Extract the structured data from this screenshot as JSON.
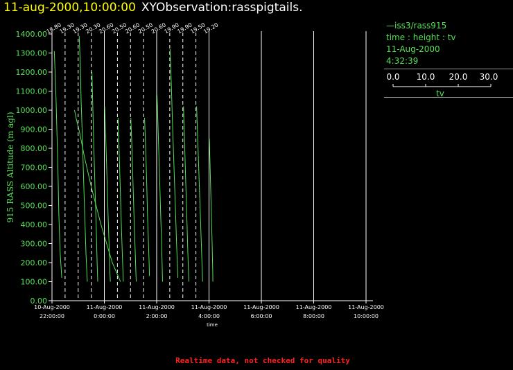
{
  "header": {
    "date": "11-aug-2000,10:00:00",
    "title": "XYObservation:rasspigtails."
  },
  "legend": {
    "source": "—iss3/rass915",
    "axes": "time : height : tv",
    "date": "11-Aug-2000",
    "time": "4:32:39",
    "scale_ticks": [
      "0.0",
      "10.0",
      "20.0",
      "30.0"
    ],
    "scale_label": "tv"
  },
  "footer": "Realtime data, not checked for quality",
  "colors": {
    "header_date": "#ffff00",
    "series": "#55e055",
    "axis": "#ffffff",
    "footer": "#ff2020"
  },
  "chart_data": {
    "type": "line",
    "ylabel": "915 RASS Altitude (m agl)",
    "xlabel": "time",
    "ylim": [
      0,
      1400
    ],
    "y_ticks": [
      "0.00",
      "100.00",
      "200.00",
      "300.00",
      "400.00",
      "500.00",
      "600.00",
      "700.00",
      "800.00",
      "900.00",
      "1000.00",
      "1100.00",
      "1200.00",
      "1300.00",
      "1400.00"
    ],
    "x_ticks": [
      {
        "date": "10-Aug-2000",
        "time": "22:00:00"
      },
      {
        "date": "11-Aug-2000",
        "time": "0:00:00"
      },
      {
        "date": "11-Aug-2000",
        "time": "2:00:00"
      },
      {
        "date": "11-Aug-2000",
        "time": "4:00:00"
      },
      {
        "date": "11-Aug-2000",
        "time": "6:00:00"
      },
      {
        "date": "11-Aug-2000",
        "time": "8:00:00"
      },
      {
        "date": "11-Aug-2000",
        "time": "10:00:00"
      }
    ],
    "profiles": [
      {
        "label": "18.80",
        "points": [
          [
            0.7,
            1310
          ],
          [
            0.95,
            1200
          ],
          [
            1.25,
            1050
          ],
          [
            1.5,
            900
          ],
          [
            1.8,
            700
          ],
          [
            2.1,
            450
          ],
          [
            2.5,
            250
          ],
          [
            3.0,
            120
          ]
        ]
      },
      {
        "label": "19.30",
        "points": [
          [
            2.9,
            1000
          ],
          [
            3.5,
            950
          ],
          [
            4.5,
            880
          ],
          [
            6.0,
            750
          ],
          [
            8.0,
            600
          ],
          [
            11.0,
            400
          ],
          [
            14.5,
            200
          ],
          [
            17.0,
            100
          ]
        ]
      },
      {
        "label": "19.30",
        "points": [
          [
            0.3,
            1390
          ],
          [
            0.65,
            1250
          ],
          [
            0.9,
            1050
          ],
          [
            1.3,
            850
          ],
          [
            1.65,
            650
          ],
          [
            2.0,
            450
          ],
          [
            2.4,
            250
          ],
          [
            2.8,
            100
          ]
        ]
      },
      {
        "label": "20.30",
        "points": [
          [
            0.2,
            1200
          ],
          [
            0.5,
            1000
          ],
          [
            0.8,
            800
          ],
          [
            1.15,
            600
          ],
          [
            1.5,
            400
          ],
          [
            1.8,
            200
          ],
          [
            2.0,
            100
          ]
        ]
      },
      {
        "label": "20.60",
        "points": [
          [
            0.1,
            1020
          ],
          [
            0.45,
            850
          ],
          [
            0.8,
            650
          ],
          [
            1.15,
            450
          ],
          [
            1.45,
            300
          ],
          [
            1.7,
            150
          ],
          [
            1.85,
            100
          ]
        ]
      },
      {
        "label": "20.50",
        "points": [
          [
            0.2,
            960
          ],
          [
            0.5,
            800
          ],
          [
            0.85,
            600
          ],
          [
            1.2,
            400
          ],
          [
            1.5,
            250
          ],
          [
            1.7,
            150
          ],
          [
            1.8,
            100
          ]
        ]
      },
      {
        "label": "20.60",
        "points": [
          [
            0.1,
            960
          ],
          [
            0.45,
            800
          ],
          [
            0.8,
            600
          ],
          [
            1.15,
            400
          ],
          [
            1.45,
            250
          ],
          [
            1.65,
            150
          ],
          [
            1.75,
            100
          ]
        ]
      },
      {
        "label": "20.50",
        "points": [
          [
            0.3,
            960
          ],
          [
            0.55,
            850
          ],
          [
            0.9,
            650
          ],
          [
            1.2,
            450
          ],
          [
            1.5,
            300
          ],
          [
            1.7,
            200
          ],
          [
            1.8,
            130
          ]
        ]
      },
      {
        "label": "20.60",
        "points": [
          [
            0.1,
            1080
          ],
          [
            0.45,
            900
          ],
          [
            0.8,
            700
          ],
          [
            1.15,
            500
          ],
          [
            1.5,
            300
          ],
          [
            1.8,
            100
          ]
        ]
      },
      {
        "label": "19.90",
        "points": [
          [
            0.1,
            1320
          ],
          [
            0.45,
            1150
          ],
          [
            0.9,
            900
          ],
          [
            1.3,
            700
          ],
          [
            1.7,
            500
          ],
          [
            2.1,
            300
          ],
          [
            2.5,
            120
          ]
        ]
      },
      {
        "label": "19.90",
        "points": [
          [
            0.2,
            1020
          ],
          [
            0.5,
            850
          ],
          [
            0.85,
            650
          ],
          [
            1.2,
            450
          ],
          [
            1.55,
            250
          ],
          [
            1.85,
            100
          ]
        ]
      },
      {
        "label": "19.50",
        "points": [
          [
            0.2,
            1020
          ],
          [
            0.55,
            850
          ],
          [
            0.95,
            650
          ],
          [
            1.35,
            450
          ],
          [
            1.75,
            250
          ],
          [
            2.05,
            100
          ]
        ]
      },
      {
        "label": "19.20",
        "points": [
          [
            0.1,
            850
          ],
          [
            0.35,
            700
          ],
          [
            0.65,
            500
          ],
          [
            0.95,
            300
          ],
          [
            1.15,
            150
          ],
          [
            1.2,
            100
          ]
        ]
      }
    ]
  }
}
